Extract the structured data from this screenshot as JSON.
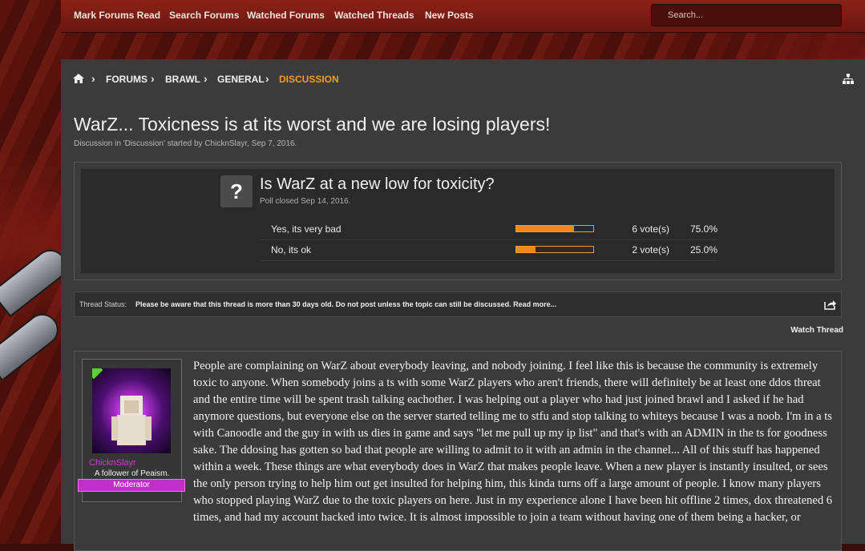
{
  "topnav": {
    "links": [
      "Mark Forums Read",
      "Search Forums",
      "Watched Forums",
      "Watched Threads",
      "New Posts"
    ],
    "search_placeholder": "Search..."
  },
  "breadcrumb": {
    "items": [
      "FORUMS",
      "BRAWL",
      "GENERAL"
    ],
    "current": "DISCUSSION",
    "home_icon": "home-icon",
    "right_icon": "sitemap-icon"
  },
  "thread": {
    "title": "WarZ... Toxicness is at its worst and we are losing players!",
    "meta": "Discussion in 'Discussion' started by ChicknSlayr, Sep 7, 2016."
  },
  "poll": {
    "icon": "?",
    "question": "Is WarZ at a new low for toxicity?",
    "status": "Poll closed Sep 14, 2016.",
    "options": [
      {
        "label": "Yes, its very bad",
        "votes": "6 vote(s)",
        "percent": "75.0%",
        "fraction": 0.75
      },
      {
        "label": "No, its ok",
        "votes": "2 vote(s)",
        "percent": "25.0%",
        "fraction": 0.25
      }
    ],
    "accent": "#ef8a17"
  },
  "status_bar": {
    "label": "Thread Status:",
    "text": "Please be aware that this thread is more than 30 days old. Do not post unless the topic can still be discussed. Read more..."
  },
  "watch_thread": "Watch Thread",
  "post": {
    "username": "ChicknSlayr",
    "user_title": "A follower of Peaism.",
    "role": "Moderator",
    "role_color": "#c12fc9",
    "body": "People are complaining on WarZ about everybody leaving, and nobody joining. I feel like this is because the community is extremely toxic to anyone. When somebody joins a ts with some WarZ players who aren't friends, there will definitely be at least one ddos threat and the entire time will be spent trash talking eachother. I was helping out a player who had just joined brawl and I asked if he had anymore questions, but everyone else on the server started telling me to stfu and stop talking to whiteys because I was a noob. I'm in a ts with Canoodle and the guy in with us dies in game and says \"let me pull up my ip list\" and that's with an ADMIN in the ts for goodness sake. The ddosing has gotten so bad that people are willing to admit to it with an admin in the channel... All of this stuff has happened within a week. These things are what everybody does in WarZ that makes people leave. When a new player is instantly insulted, or sees the only person trying to help him out get insulted for helping him, this kinda turns off a large amount of people. I know many players who stopped playing WarZ due to the toxic players on here. Just in my experience alone I have been hit offline 2 times, dox threatened 6 times, and had my account hacked into twice. It is almost impossible to join a team without having one of them being a hacker, or"
  }
}
